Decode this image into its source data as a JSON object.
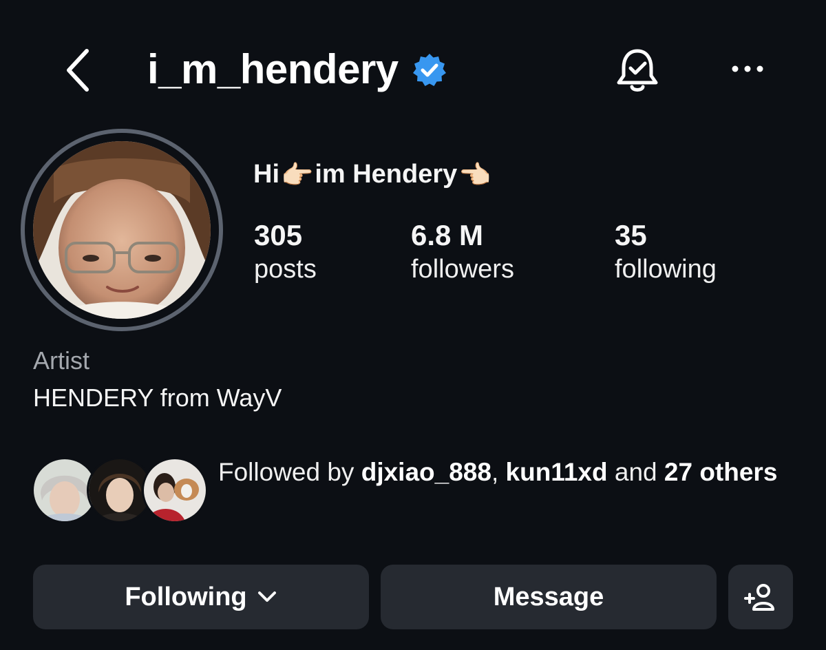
{
  "header": {
    "username": "i_m_hendery",
    "icons": {
      "back": "chevron-left-icon",
      "verified": "verified-badge-icon",
      "notifications": "bell-check-icon",
      "more": "more-horizontal-icon"
    }
  },
  "profile": {
    "display_name": {
      "prefix": "Hi",
      "middle": "im Hendery",
      "hand_emoji_left": "👉🏻",
      "hand_emoji_right": "👈🏻"
    },
    "stats": {
      "posts": {
        "value": "305",
        "label": "posts"
      },
      "followers": {
        "value": "6.8 M",
        "label": "followers"
      },
      "following": {
        "value": "35",
        "label": "following"
      }
    },
    "category": "Artist",
    "bio": "HENDERY from WayV"
  },
  "followed_by": {
    "prefix": "Followed by",
    "user1": "djxiao_888",
    "separator": ",",
    "user2": "kun11xd",
    "conjunction": "and",
    "count_text": "27",
    "suffix": "others"
  },
  "actions": {
    "following_label": "Following",
    "message_label": "Message",
    "add_user_icon": "add-user-icon"
  },
  "colors": {
    "background": "#0c0f14",
    "button": "#262a31",
    "verified": "#3897f0",
    "muted_text": "#a4a8ae"
  }
}
